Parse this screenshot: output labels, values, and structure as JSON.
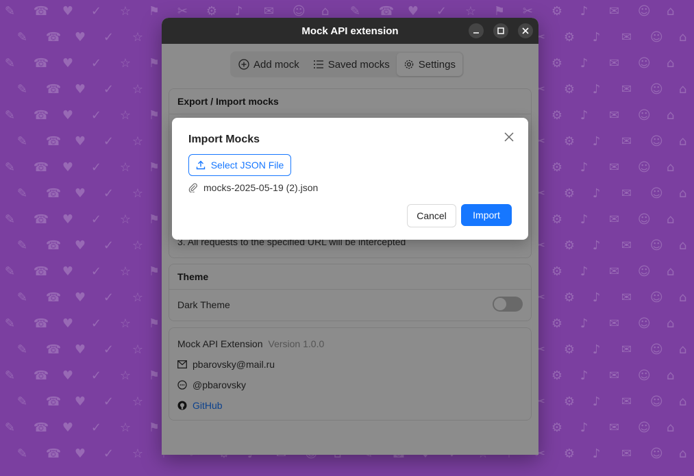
{
  "window": {
    "title": "Mock API extension"
  },
  "tabs": [
    {
      "label": "Add mock",
      "icon": "plus-circle-icon"
    },
    {
      "label": "Saved mocks",
      "icon": "list-icon"
    },
    {
      "label": "Settings",
      "icon": "gear-icon",
      "active": true
    }
  ],
  "export_import": {
    "title": "Export / Import mocks",
    "step3": "3. All requests to the specified URL will be intercepted"
  },
  "theme": {
    "title": "Theme",
    "dark_label": "Dark Theme",
    "dark_enabled": false
  },
  "about": {
    "name": "Mock API Extension",
    "version": "Version 1.0.0",
    "email": "pbarovsky@mail.ru",
    "telegram": "@pbarovsky",
    "github": "GitHub"
  },
  "modal": {
    "title": "Import Mocks",
    "select_label": "Select JSON File",
    "file_name": "mocks-2025-05-19 (2).json",
    "cancel_label": "Cancel",
    "import_label": "Import"
  },
  "colors": {
    "accent": "#1677ff",
    "titlebar": "#2b2b2b",
    "wallpaper": "#7b3fa0"
  }
}
